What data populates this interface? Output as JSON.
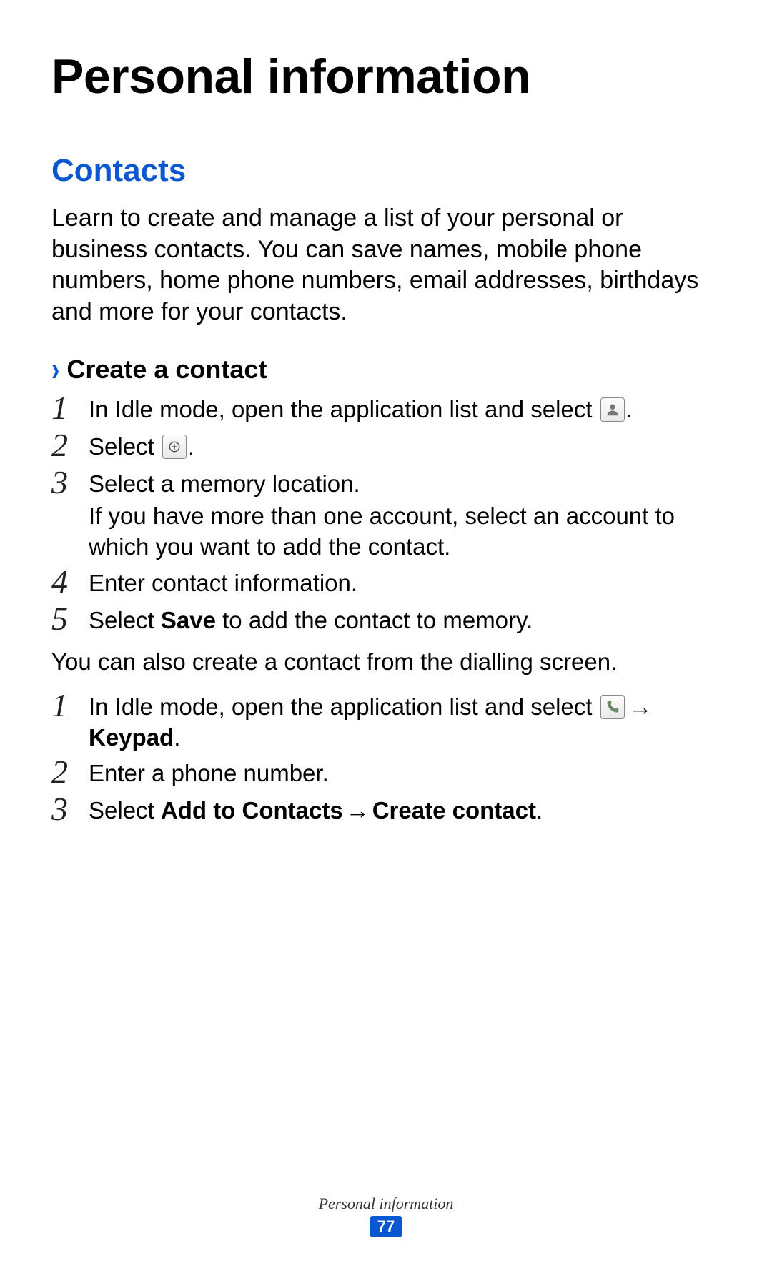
{
  "title": "Personal information",
  "section": "Contacts",
  "intro": "Learn to create and manage a list of your personal or business contacts. You can save names, mobile phone numbers, home phone numbers, email addresses, birthdays and more for your contacts.",
  "subsection": "Create a contact",
  "stepsA": {
    "s1": {
      "n": "1",
      "a": "In Idle mode, open the application list and select ",
      "b": "."
    },
    "s2": {
      "n": "2",
      "a": "Select ",
      "b": "."
    },
    "s3": {
      "n": "3",
      "a": "Select a memory location.",
      "sub": "If you have more than one account, select an account to which you want to add the contact."
    },
    "s4": {
      "n": "4",
      "a": "Enter contact information."
    },
    "s5": {
      "n": "5",
      "a": "Select ",
      "bold": "Save",
      "b": " to add the contact to memory."
    }
  },
  "between": "You can also create a contact from the dialling screen.",
  "stepsB": {
    "s1": {
      "n": "1",
      "a": "In Idle mode, open the application list and select ",
      "arrow": " → ",
      "bold": "Keypad",
      "b": "."
    },
    "s2": {
      "n": "2",
      "a": "Enter a phone number."
    },
    "s3": {
      "n": "3",
      "a": "Select ",
      "bold1": "Add to Contacts",
      "arrow": " → ",
      "bold2": "Create contact",
      "b": "."
    }
  },
  "footer": {
    "title": "Personal information",
    "page": "77"
  },
  "icons": {
    "contacts": "contacts-icon",
    "add": "add-icon",
    "phone": "phone-icon"
  }
}
